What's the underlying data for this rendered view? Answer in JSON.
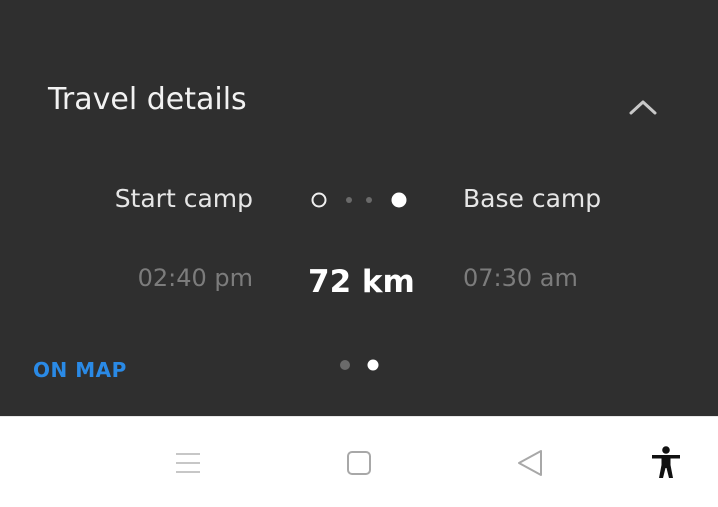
{
  "travel_details": {
    "title": "Travel details",
    "start": {
      "name": "Start camp",
      "time": "02:40 pm"
    },
    "end": {
      "name": "Base camp",
      "time": "07:30 am"
    },
    "distance": "72 km",
    "on_map_label": "ON MAP",
    "pager": {
      "pages": 2,
      "current": 2
    }
  },
  "colors": {
    "card_background": "#2f2f2f",
    "accent_link": "#2a8ae6",
    "navbar_background": "#ffffff"
  },
  "navbar": {
    "icons": [
      "menu-icon",
      "home-square-icon",
      "back-triangle-icon",
      "accessibility-icon"
    ]
  }
}
